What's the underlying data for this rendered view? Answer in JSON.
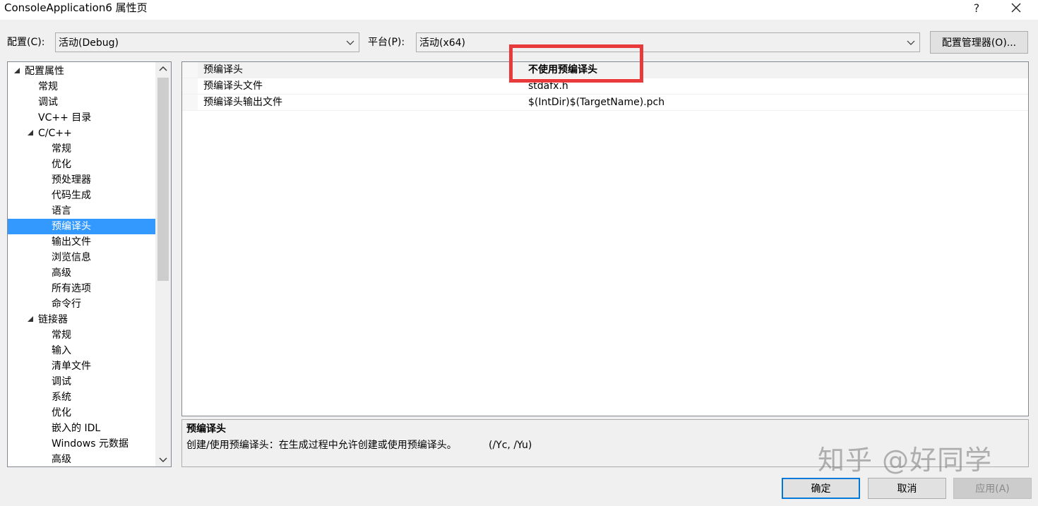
{
  "window": {
    "title": "ConsoleApplication6 属性页",
    "help_label": "?",
    "close_icon": "close-icon"
  },
  "toolbar": {
    "config_label": "配置(C):",
    "config_value": "活动(Debug)",
    "platform_label": "平台(P):",
    "platform_value": "活动(x64)",
    "config_manager_label": "配置管理器(O)..."
  },
  "tree": {
    "items": [
      {
        "label": "配置属性",
        "level": 0,
        "expanded": true
      },
      {
        "label": "常规",
        "level": 1
      },
      {
        "label": "调试",
        "level": 1
      },
      {
        "label": "VC++ 目录",
        "level": 1
      },
      {
        "label": "C/C++",
        "level": 1,
        "expanded": true
      },
      {
        "label": "常规",
        "level": 2
      },
      {
        "label": "优化",
        "level": 2
      },
      {
        "label": "预处理器",
        "level": 2
      },
      {
        "label": "代码生成",
        "level": 2
      },
      {
        "label": "语言",
        "level": 2
      },
      {
        "label": "预编译头",
        "level": 2,
        "selected": true
      },
      {
        "label": "输出文件",
        "level": 2
      },
      {
        "label": "浏览信息",
        "level": 2
      },
      {
        "label": "高级",
        "level": 2
      },
      {
        "label": "所有选项",
        "level": 2
      },
      {
        "label": "命令行",
        "level": 2
      },
      {
        "label": "链接器",
        "level": 1,
        "expanded": true
      },
      {
        "label": "常规",
        "level": 2
      },
      {
        "label": "输入",
        "level": 2
      },
      {
        "label": "清单文件",
        "level": 2
      },
      {
        "label": "调试",
        "level": 2
      },
      {
        "label": "系统",
        "level": 2
      },
      {
        "label": "优化",
        "level": 2
      },
      {
        "label": "嵌入的 IDL",
        "level": 2
      },
      {
        "label": "Windows 元数据",
        "level": 2
      },
      {
        "label": "高级",
        "level": 2
      }
    ]
  },
  "properties": [
    {
      "name": "预编译头",
      "value": "不使用预编译头",
      "bold": true,
      "selected": true
    },
    {
      "name": "预编译头文件",
      "value": "stdafx.h"
    },
    {
      "name": "预编译头输出文件",
      "value": "$(IntDir)$(TargetName).pch"
    }
  ],
  "description": {
    "title": "预编译头",
    "text": "创建/使用预编译头：在生成过程中允许创建或使用预编译头。",
    "switches": "(/Yc, /Yu)"
  },
  "buttons": {
    "ok": "确定",
    "cancel": "取消",
    "apply": "应用(A)"
  },
  "watermark": "知乎 @好同学",
  "colors": {
    "selection": "#3399ff",
    "highlight_box": "#e83a3a",
    "primary_border": "#0078d7"
  }
}
